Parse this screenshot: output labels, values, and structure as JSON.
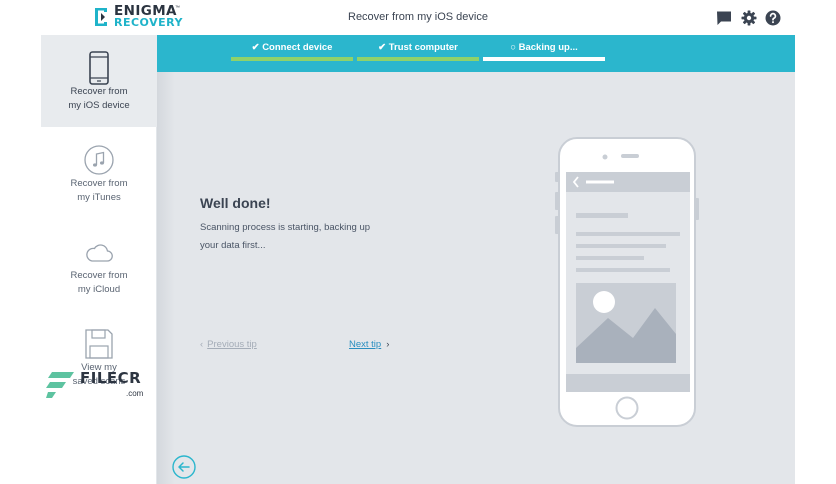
{
  "app": {
    "logo_line1": "ENIGMA",
    "logo_tm": "™",
    "logo_line2": "RECOVERY",
    "window_title": "Recover from my iOS device",
    "icons": [
      "chat-icon",
      "gear-icon",
      "help-icon"
    ]
  },
  "sidebar": {
    "items": [
      {
        "line1": "Recover from",
        "line2": "my iOS device",
        "icon": "phone-icon",
        "active": true
      },
      {
        "line1": "Recover from",
        "line2": "my iTunes",
        "icon": "music-note-icon",
        "active": false
      },
      {
        "line1": "Recover from",
        "line2": "my iCloud",
        "icon": "cloud-icon",
        "active": false
      },
      {
        "line1": "View my",
        "line2": "saved scans",
        "icon": "floppy-disk-icon",
        "active": false
      }
    ]
  },
  "steps": [
    {
      "label": "Connect device",
      "status": "done",
      "glyph": "✔"
    },
    {
      "label": "Trust computer",
      "status": "done",
      "glyph": "✔"
    },
    {
      "label": "Backing up...",
      "status": "current",
      "glyph": "○"
    }
  ],
  "main": {
    "title": "Well done!",
    "text_line1": "Scanning process is starting, backing up",
    "text_line2": "your data first...",
    "prev_tip": "Previous tip",
    "next_tip": "Next tip"
  },
  "watermark": {
    "text": "FILECR",
    "domain": ".com"
  },
  "colors": {
    "accent": "#2bb6cd",
    "done_bar": "#8fd26a",
    "brand_teal": "#1fb3c9",
    "main_bg": "#e3e6ea",
    "link": "#2b8fc0"
  }
}
